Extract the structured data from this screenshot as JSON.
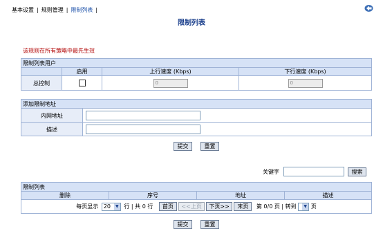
{
  "nav": {
    "items": [
      {
        "label": "基本设置"
      },
      {
        "label": "规则管理"
      },
      {
        "label": "限制列表"
      }
    ],
    "separator": "|"
  },
  "page_title": "限制列表",
  "notice": "该规则在所有策略中最先生效",
  "users_section": {
    "title": "限制列表用户",
    "col_enable": "启用",
    "col_up": "上行速度 (Kbps)",
    "col_down": "下行速度 (Kbps)",
    "row_label": "总控制",
    "up_value": "0",
    "down_value": "0"
  },
  "add_section": {
    "title": "添加限制地址",
    "field_intranet": "内网地址",
    "field_desc": "描述"
  },
  "buttons": {
    "submit": "提交",
    "reset": "重置"
  },
  "search": {
    "label": "关键字",
    "button": "搜索"
  },
  "list_section": {
    "title": "限制列表",
    "columns": [
      "删除",
      "序号",
      "地址",
      "描述"
    ]
  },
  "pager": {
    "per_page_label": "每页显示",
    "per_page_value": "20",
    "rows_label": "行 | 共",
    "total_rows": "0",
    "rows_unit": "行",
    "first": "首页",
    "prev": "<<上页",
    "next": "下页>>",
    "last": "末页",
    "page_prefix": "第",
    "page_value": "0/0",
    "page_suffix": "页 | 转到",
    "goto_suffix": "页"
  }
}
